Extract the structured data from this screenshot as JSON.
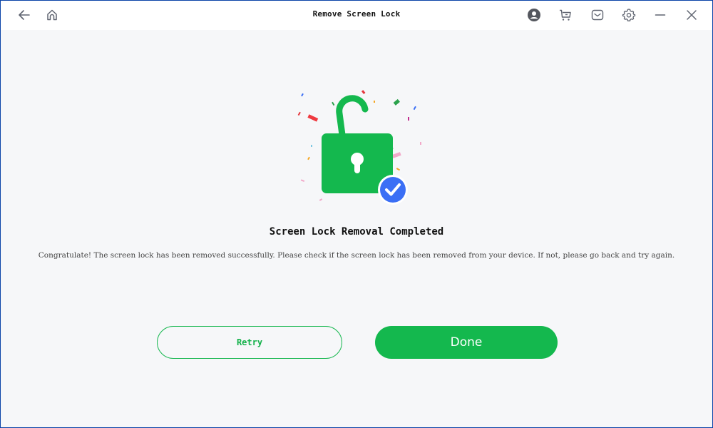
{
  "window": {
    "title": "Remove Screen Lock"
  },
  "titlebar": {
    "left_icons": [
      "back-arrow-icon",
      "home-icon"
    ],
    "right_icons": [
      "account-icon",
      "cart-icon",
      "mail-icon",
      "settings-icon",
      "minimize-icon",
      "close-icon"
    ]
  },
  "result": {
    "illustration": "unlocked-padlock-with-check",
    "heading": "Screen Lock Removal Completed",
    "description": "Congratulate! The screen lock has been removed successfully. Please check if the screen lock has been removed from your device. If not, please go back and try again."
  },
  "actions": {
    "retry_label": "Retry",
    "done_label": "Done"
  },
  "colors": {
    "accent_green": "#14b84e",
    "check_blue": "#3b6ff5",
    "window_border": "#0a43a8"
  }
}
